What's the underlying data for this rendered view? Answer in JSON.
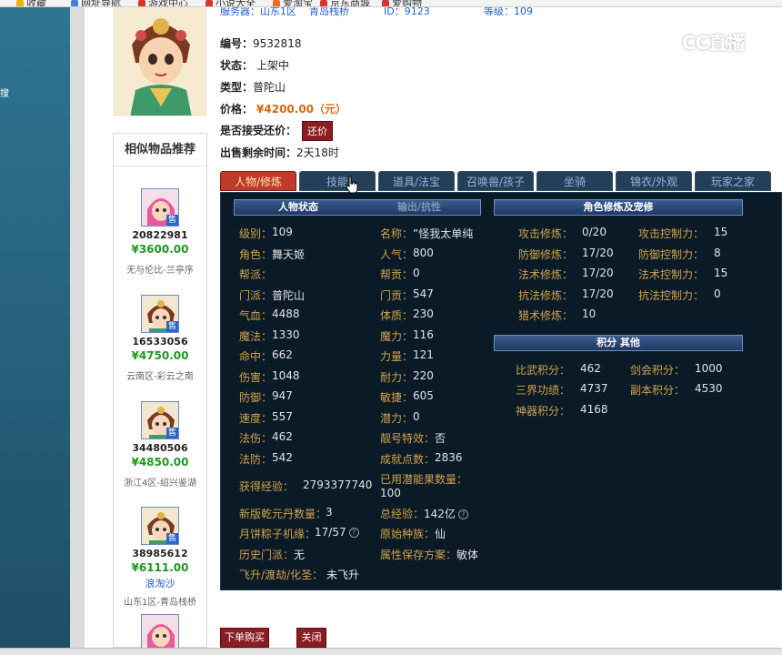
{
  "bookmarks": [
    "收藏",
    "网址导航",
    "游戏中心",
    "小说大全",
    "爱淘宝",
    "京东商城",
    "爱购物"
  ],
  "top_strip": [
    "服务器：山东1区",
    "青岛栈桥",
    "ID：9123",
    "等级：109"
  ],
  "item": {
    "id_label": "编号：",
    "id": "9532818",
    "status_label": "状态：",
    "status": "上架中",
    "type_label": "类型：",
    "type": "普陀山",
    "price_label": "价格：",
    "price": "¥4200.00（元）",
    "bargain_label": "是否接受还价：",
    "bargain_button": "还价",
    "remain_label": "出售剩余时间：",
    "remain": "2天18时"
  },
  "similar": {
    "title": "相似物品推荐",
    "badge": "售",
    "items": [
      {
        "id": "20822981",
        "price": "¥3600.00",
        "info": "无与伦比-兰亭序",
        "portrait": "pink"
      },
      {
        "id": "16533056",
        "price": "¥4750.00",
        "info": "云南区-彩云之南",
        "portrait": "green"
      },
      {
        "id": "34480506",
        "price": "¥4850.00",
        "info": "浙江4区-绍兴鉴湖",
        "portrait": "green"
      },
      {
        "id": "38985612",
        "price": "¥6111.00",
        "seller": "浪淘沙",
        "info": "山东1区-青岛栈桥",
        "portrait": "green"
      }
    ]
  },
  "tabs": [
    "人物/修炼",
    "技能",
    "道具/法宝",
    "召唤兽/孩子",
    "坐骑",
    "锦衣/外观",
    "玩家之家"
  ],
  "panel": {
    "status_head": "人物状态",
    "resist_head": "输出/抗性",
    "cultivation_head": "角色修炼及宠修",
    "score_head": "积分 其他",
    "left_stats": [
      {
        "label": "级别：",
        "value": "109"
      },
      {
        "label": "角色：",
        "value": "舞天姬"
      },
      {
        "label": "帮派：",
        "value": ""
      },
      {
        "label": "门派：",
        "value": "普陀山"
      },
      {
        "label": "气血：",
        "value": "4488"
      },
      {
        "label": "魔法：",
        "value": "1330"
      },
      {
        "label": "命中：",
        "value": "662"
      },
      {
        "label": "伤害：",
        "value": "1048"
      },
      {
        "label": "防御：",
        "value": "947"
      },
      {
        "label": "速度：",
        "value": "557"
      },
      {
        "label": "法伤：",
        "value": "462"
      },
      {
        "label": "法防：",
        "value": "542"
      }
    ],
    "right_stats": [
      {
        "label": "名称：",
        "value": "”怪我太单纯"
      },
      {
        "label": "人气：",
        "value": "800"
      },
      {
        "label": "帮贡：",
        "value": "0"
      },
      {
        "label": "门贡：",
        "value": "547"
      },
      {
        "label": "体质：",
        "value": "230"
      },
      {
        "label": "魔力：",
        "value": "116"
      },
      {
        "label": "力量：",
        "value": "121"
      },
      {
        "label": "耐力：",
        "value": "220"
      },
      {
        "label": "敏捷：",
        "value": "605"
      },
      {
        "label": "潜力：",
        "value": "0"
      },
      {
        "label": "靓号特效：",
        "value": "否"
      },
      {
        "label": "成就点数：",
        "value": "2836"
      }
    ],
    "extra_left": [
      {
        "label": "获得经验：",
        "value": "2793377740"
      },
      {
        "label": "新版乾元丹数量：",
        "value": "3"
      },
      {
        "label": "月饼粽子机缘：",
        "value": "17/57"
      },
      {
        "label": "历史门派：",
        "value": "无"
      },
      {
        "label": "飞升/渡劫/化圣：",
        "value": "未飞升"
      }
    ],
    "extra_right": [
      {
        "label": "已用潜能果数量：",
        "value": "100"
      },
      {
        "label": "总经验：",
        "value": "142亿"
      },
      {
        "label": "原始种族：",
        "value": "仙"
      },
      {
        "label": "属性保存方案：",
        "value": "敏体"
      }
    ],
    "cultivation": [
      {
        "label": "攻击修炼：",
        "value": "0/20",
        "label2": "攻击控制力：",
        "value2": "15"
      },
      {
        "label": "防御修炼：",
        "value": "17/20",
        "label2": "防御控制力：",
        "value2": "8"
      },
      {
        "label": "法术修炼：",
        "value": "17/20",
        "label2": "法术控制力：",
        "value2": "15"
      },
      {
        "label": "抗法修炼：",
        "value": "17/20",
        "label2": "抗法控制力：",
        "value2": "0"
      },
      {
        "label": "猎术修炼：",
        "value": "10",
        "label2": "",
        "value2": ""
      }
    ],
    "scores": [
      {
        "label": "比武积分：",
        "value": "462",
        "label2": "剑会积分：",
        "value2": "1000"
      },
      {
        "label": "三界功绩：",
        "value": "4737",
        "label2": "副本积分：",
        "value2": "4530"
      },
      {
        "label": "神器积分：",
        "value": "4168",
        "label2": "",
        "value2": ""
      }
    ]
  },
  "buttons": {
    "buy": "下单购买",
    "close": "关闭"
  },
  "watermark": "CC直播",
  "side_mark": "搜",
  "colors": {
    "tab_active": "#c0392b",
    "panel_bg": "#0a1a26",
    "label_gold": "#d3a14b",
    "price_orange": "#d9690c",
    "price_green": "#1d9a1d"
  }
}
